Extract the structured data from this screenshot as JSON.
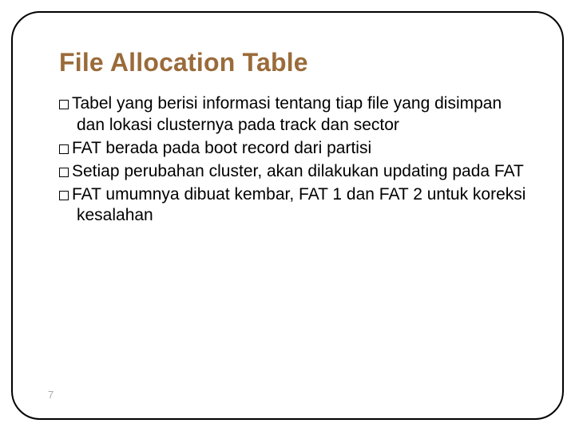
{
  "title": "File Allocation Table",
  "bullets": [
    "Tabel yang berisi informasi tentang tiap file yang disimpan dan lokasi clusternya pada track dan sector",
    "FAT berada pada boot record dari partisi",
    "Setiap perubahan cluster, akan dilakukan updating pada FAT",
    "FAT umumnya dibuat kembar, FAT 1 dan FAT 2 untuk koreksi kesalahan"
  ],
  "pageNumber": "7"
}
